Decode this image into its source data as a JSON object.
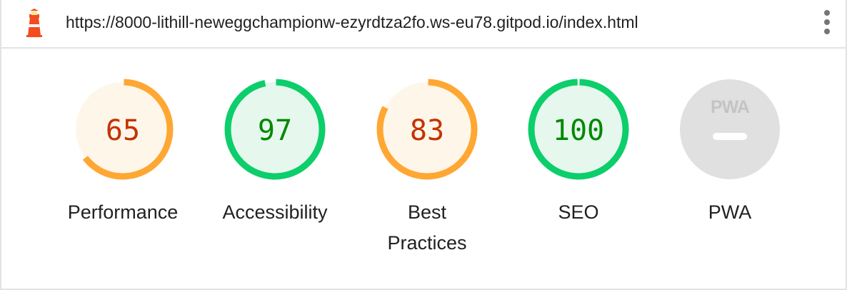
{
  "header": {
    "url": "https://8000-lithill-neweggchampionw-ezyrdtza2fo.ws-eu78.gitpod.io/index.html",
    "logo_icon": "lighthouse-icon",
    "menu_icon": "vertical-dots-icon"
  },
  "gauges": [
    {
      "label": "Performance",
      "score": 65,
      "display": "65",
      "rating": "average"
    },
    {
      "label": "Accessibility",
      "score": 97,
      "display": "97",
      "rating": "pass"
    },
    {
      "label": "Best Practices",
      "score": 83,
      "display": "83",
      "rating": "average"
    },
    {
      "label": "SEO",
      "score": 100,
      "display": "100",
      "rating": "pass"
    },
    {
      "label": "PWA",
      "badge_text": "PWA",
      "rating": "na"
    }
  ],
  "colors": {
    "average_stroke": "#ffa733",
    "average_fill": "#fff6ea",
    "average_text": "#c33300",
    "pass_stroke": "#0cce6b",
    "pass_fill": "#e6f8ee",
    "pass_text": "#008800",
    "na_fill": "#e0e0e0",
    "na_text": "#ffffff",
    "na_badge": "#c4c4c4"
  }
}
